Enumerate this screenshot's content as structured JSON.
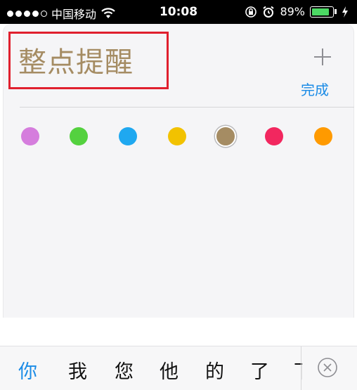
{
  "status_bar": {
    "carrier": "中国移动",
    "time": "10:08",
    "battery_percent": "89%",
    "battery_level": 0.89,
    "signal_bars_filled": 4,
    "signal_bars_total": 5
  },
  "note": {
    "title": "整点提醒",
    "done_label": "完成",
    "add_icon": "plus-icon"
  },
  "colors": {
    "swatches": [
      "#d57ddd",
      "#54d13f",
      "#1fa8f0",
      "#f2c200",
      "#a58c63",
      "#f2275f",
      "#ff9a00"
    ],
    "selected_index": 4,
    "title_color": "#a58c63",
    "accent": "#1a8be6",
    "highlight_box": "#e0202e"
  },
  "keyboard": {
    "candidates": [
      "你",
      "我",
      "您",
      "他",
      "的",
      "了",
      "下"
    ],
    "collapse_icon": "close-circle-icon"
  }
}
